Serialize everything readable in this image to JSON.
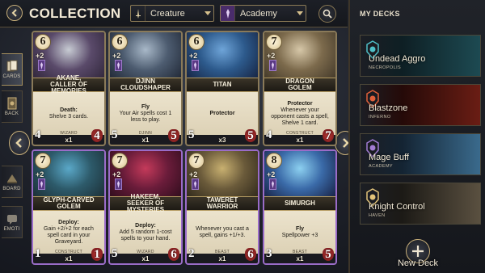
{
  "header": {
    "title": "COLLECTION",
    "filter_type": "Creature",
    "filter_faction": "Academy"
  },
  "side_tabs": [
    {
      "label": "CARDS",
      "icon": "cards-icon",
      "active": true
    },
    {
      "label": "BACK",
      "icon": "card-back-icon",
      "active": false
    },
    {
      "label": "BOARD",
      "icon": "board-icon",
      "active": false
    },
    {
      "label": "EMOTI",
      "icon": "emote-icon",
      "active": false
    }
  ],
  "cards": [
    {
      "cost": "6",
      "bonus": "+2",
      "name": "AKANE, CALLER OF MEMORIES",
      "text_bold": "Death:",
      "text": "Shelve 3 cards.",
      "type": "WIZARD",
      "count": "x1",
      "atk": "4",
      "hp": "4",
      "art": [
        "#c7cbd3",
        "#5a4a6a",
        "#2c2336"
      ]
    },
    {
      "cost": "6",
      "bonus": "+2",
      "name": "DJINN CLOUDSHAPER",
      "text_bold": "Fly",
      "text": "Your Air spells cost 1 less to play.",
      "type": "DJINN",
      "count": "x1",
      "atk": "5",
      "hp": "5",
      "art": [
        "#a8b8c8",
        "#4d5c70",
        "#1c2330"
      ]
    },
    {
      "cost": "6",
      "bonus": "+2",
      "name": "TITAN",
      "text_bold": "Protector",
      "text": "",
      "type": "",
      "count": "x3",
      "atk": "5",
      "hp": "5",
      "art": [
        "#6ea4d8",
        "#2d5a8c",
        "#141e3a"
      ]
    },
    {
      "cost": "7",
      "bonus": "+2",
      "name": "DRAGON GOLEM",
      "text_bold": "Protector",
      "text": "Whenever your opponent casts a spell, Shelve 1 card.",
      "type": "CONSTRUCT",
      "count": "x1",
      "atk": "4",
      "hp": "7",
      "art": [
        "#d6c7a8",
        "#7c6a4c",
        "#3d3426"
      ]
    },
    {
      "cost": "7",
      "bonus": "+2",
      "name": "GLYPH-CARVED GOLEM",
      "text_bold": "Deploy:",
      "text": "Gain +2/+2 for each spell card in your Graveyard.",
      "type": "CONSTRUCT",
      "count": "x1",
      "atk": "1",
      "hp": "1",
      "art": [
        "#5aa8c8",
        "#2d5a6a",
        "#1a2a30"
      ]
    },
    {
      "cost": "7",
      "bonus": "+2",
      "name": "HAKEEM, SEEKER OF MYSTERIES",
      "text_bold": "Deploy:",
      "text": "Add 5 random 1-cost spells to your hand.",
      "type": "WIZARD",
      "count": "x1",
      "atk": "5",
      "hp": "6",
      "art": [
        "#c43a5a",
        "#6a1c3a",
        "#2a0c1a"
      ]
    },
    {
      "cost": "7",
      "bonus": "+2",
      "name": "TAWERET WARRIOR",
      "text_bold": "",
      "text": "Whenever you cast a spell, gains +1/+3.",
      "type": "BEAST",
      "count": "x1",
      "atk": "2",
      "hp": "6",
      "art": [
        "#c8b070",
        "#6a5a3a",
        "#2a2418"
      ]
    },
    {
      "cost": "8",
      "bonus": "+2",
      "name": "SIMURGH",
      "text_bold": "Fly",
      "text": "Spellpower +3",
      "type": "BEAST",
      "count": "x1",
      "atk": "3",
      "hp": "5",
      "art": [
        "#8cd0f0",
        "#3a6aa8",
        "#141a3a"
      ]
    }
  ],
  "my_decks": {
    "title": "MY DECKS",
    "decks": [
      {
        "name": "Undead Aggro",
        "faction": "NECROPOLIS",
        "colors": [
          "#1d4a52",
          "#0e1f24"
        ],
        "emblem": "necropolis-emblem-icon",
        "emblem_color": "#4fc0c8"
      },
      {
        "name": "Blastzone",
        "faction": "INFERNO",
        "colors": [
          "#6a1d14",
          "#250a08"
        ],
        "emblem": "inferno-emblem-icon",
        "emblem_color": "#e0603a"
      },
      {
        "name": "Mage Buff",
        "faction": "ACADEMY",
        "colors": [
          "#3a6a8c",
          "#142433"
        ],
        "emblem": "academy-emblem-icon",
        "emblem_color": "#a27cd4"
      },
      {
        "name": "Knight Control",
        "faction": "HAVEN",
        "colors": [
          "#5a5040",
          "#1c1a16"
        ],
        "emblem": "haven-emblem-icon",
        "emblem_color": "#e3c47a"
      }
    ],
    "new_deck_label": "New Deck"
  }
}
